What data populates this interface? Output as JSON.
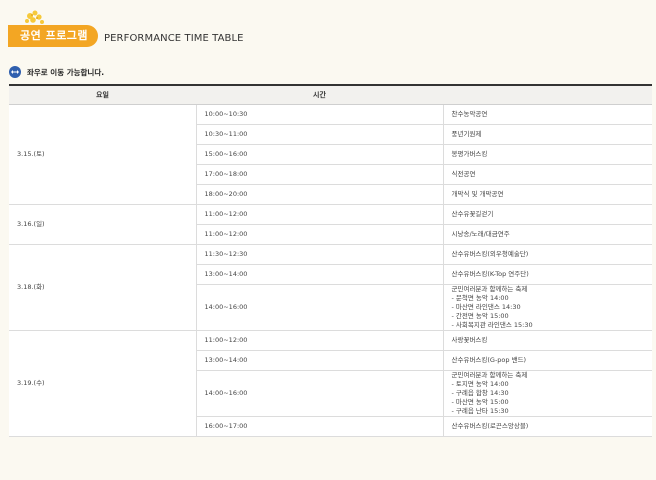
{
  "header": {
    "badge": "공연 프로그램",
    "subtitle": "PERFORMANCE TIME TABLE"
  },
  "notice": {
    "text": "좌우로 이동 가능합니다.",
    "icon": "swipe-arrows-icon"
  },
  "table": {
    "headers": [
      "요일",
      "시간",
      ""
    ],
    "days": [
      {
        "day": "3.15.(토)",
        "rows": [
          {
            "time": "10:00~10:30",
            "program": [
              "찬수농악공연"
            ]
          },
          {
            "time": "10:30~11:00",
            "program": [
              "풍년기원제"
            ]
          },
          {
            "time": "15:00~16:00",
            "program": [
              "봉평가버스킹"
            ]
          },
          {
            "time": "17:00~18:00",
            "program": [
              "식전공연"
            ]
          },
          {
            "time": "18:00~20:00",
            "program": [
              "개막식 및 개막공연"
            ]
          }
        ]
      },
      {
        "day": "3.16.(일)",
        "rows": [
          {
            "time": "11:00~12:00",
            "program": [
              "산수유꽃길걷기"
            ]
          },
          {
            "time": "11:00~12:00",
            "program": [
              "시낭송/노래/대금연주"
            ]
          }
        ]
      },
      {
        "day": "3.18.(화)",
        "rows": [
          {
            "time": "11:30~12:30",
            "program": [
              "산수유버스킹(외우청예술단)"
            ]
          },
          {
            "time": "13:00~14:00",
            "program": [
              "산수유버스킹(K-Top 연주단)"
            ]
          },
          {
            "time": "14:00~16:00",
            "program": [
              "군민여러분과 함께하는 축제",
              "- 문척면 농악 14:00",
              "- 마산면 라인댄스 14:30",
              "- 간전면 농악 15:00",
              "- 사회복지관 라인댄스 15:30"
            ]
          }
        ]
      },
      {
        "day": "3.19.(수)",
        "rows": [
          {
            "time": "11:00~12:00",
            "program": [
              "사랑꽃버스킹"
            ]
          },
          {
            "time": "13:00~14:00",
            "program": [
              "산수유버스킹(G-pop 밴드)"
            ]
          },
          {
            "time": "14:00~16:00",
            "program": [
              "군민여러분과 함께하는 축제",
              "- 토지면 농악 14:00",
              "- 구례읍 합창 14:30",
              "- 마산면 농악 15:00",
              "- 구례읍 난타 15:30"
            ]
          },
          {
            "time": "16:00~17:00",
            "program": [
              "산수유버스킹(로끈스앙상블)"
            ]
          }
        ]
      }
    ]
  },
  "colors": {
    "accent": "#f3a623",
    "icon_blue": "#2f5fae",
    "background": "#fbf9f1"
  }
}
